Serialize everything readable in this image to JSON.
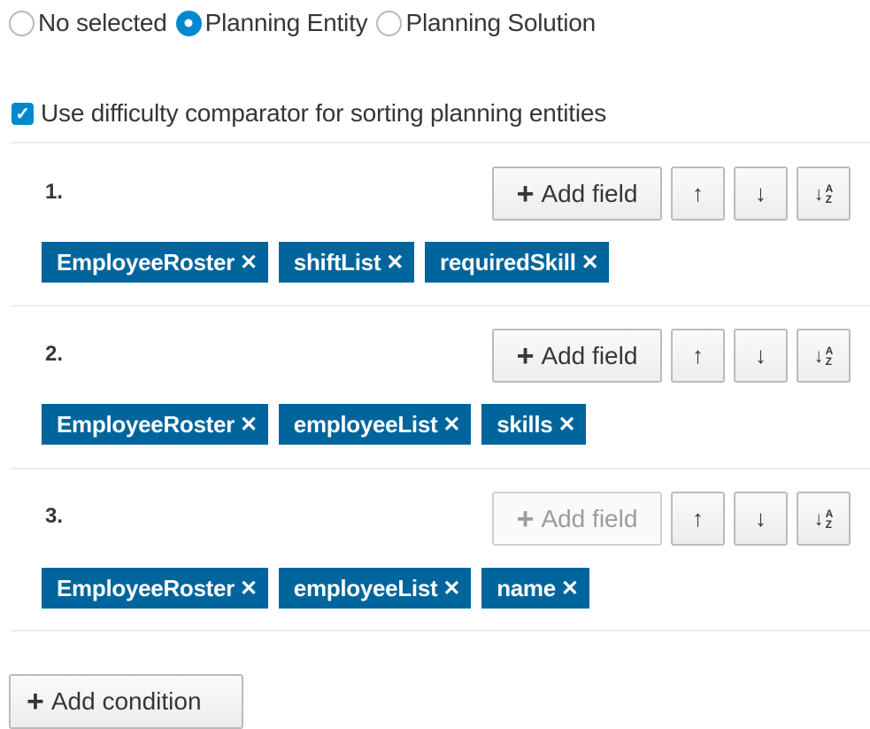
{
  "mode_options": [
    {
      "label": "No selected",
      "checked": false
    },
    {
      "label": "Planning Entity",
      "checked": true
    },
    {
      "label": "Planning Solution",
      "checked": false
    }
  ],
  "difficulty_checkbox": {
    "label": "Use difficulty comparator for sorting planning entities",
    "checked": true
  },
  "add_field_label": "Add field",
  "icons": {
    "plus": "+",
    "up": "↑",
    "down": "↓",
    "sort": "↓",
    "sort_a": "A",
    "sort_z": "Z",
    "remove": "✕",
    "check": "✓"
  },
  "conditions": [
    {
      "number": "1.",
      "add_field_disabled": false,
      "tags": [
        "EmployeeRoster",
        "shiftList",
        "requiredSkill"
      ]
    },
    {
      "number": "2.",
      "add_field_disabled": false,
      "tags": [
        "EmployeeRoster",
        "employeeList",
        "skills"
      ]
    },
    {
      "number": "3.",
      "add_field_disabled": true,
      "tags": [
        "EmployeeRoster",
        "employeeList",
        "name"
      ]
    }
  ],
  "add_condition_label": "Add condition",
  "colors": {
    "accent": "#0088ce",
    "tag_bg": "#00659c",
    "text": "#363636"
  }
}
